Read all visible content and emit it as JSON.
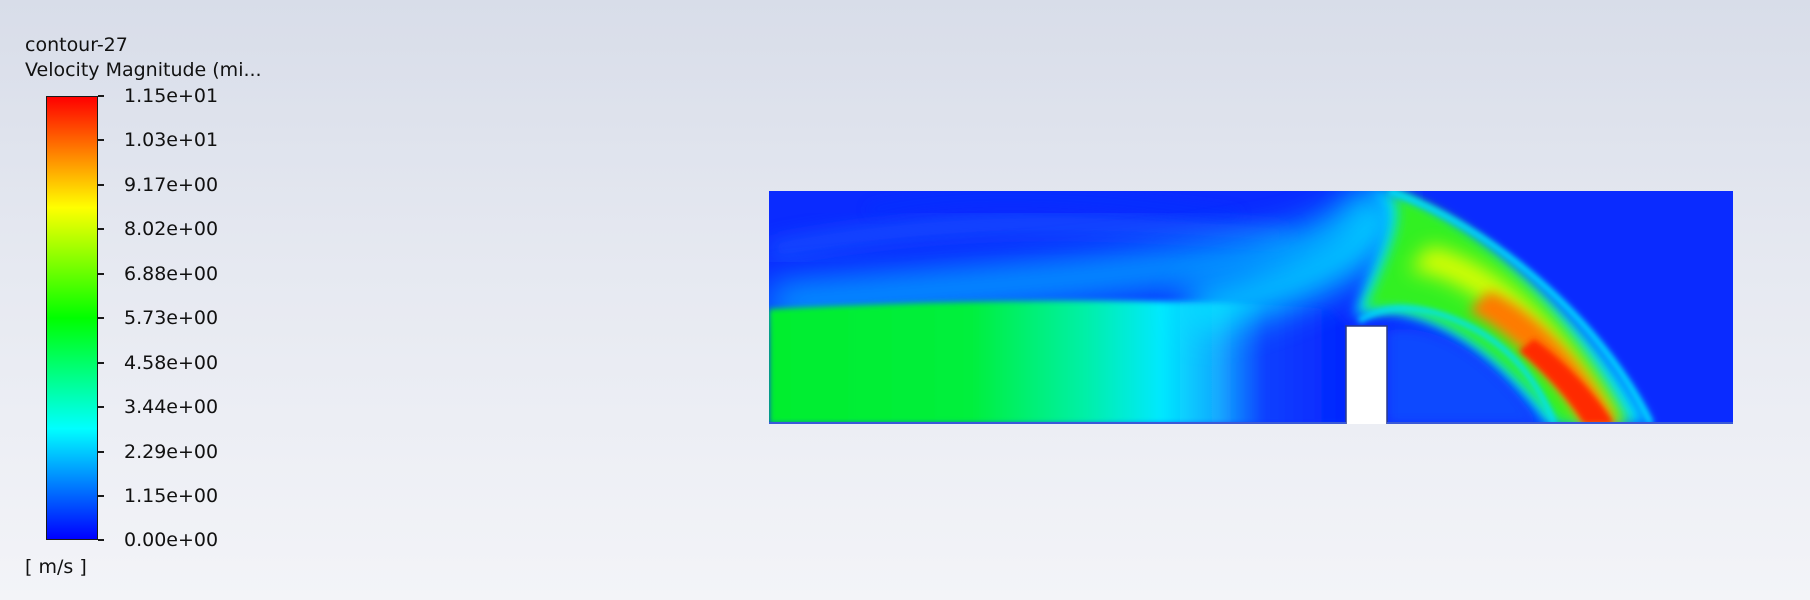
{
  "legend": {
    "title": "contour-27",
    "variable": "Velocity Magnitude (mi...",
    "units": "m/s",
    "units_open": "[",
    "units_close": "]",
    "tick_labels": [
      "1.15e+01",
      "1.03e+01",
      "9.17e+00",
      "8.02e+00",
      "6.88e+00",
      "5.73e+00",
      "4.58e+00",
      "3.44e+00",
      "2.29e+00",
      "1.15e+00",
      "0.00e+00"
    ],
    "range": [
      0.0,
      11.5
    ],
    "colormap": [
      "#0000ff",
      "#0080ff",
      "#00ffff",
      "#00ff80",
      "#00ff00",
      "#80ff00",
      "#ffff00",
      "#ff8000",
      "#ff0000"
    ]
  },
  "field": {
    "colors": {
      "background_flow": "#0a2bff",
      "inlet_jet": "#00ee2a",
      "cyan_band": "#00e6ff",
      "jet_core": "#ff3a00",
      "obstacle": "#ffffff",
      "outline": "#2a3a8a"
    }
  }
}
